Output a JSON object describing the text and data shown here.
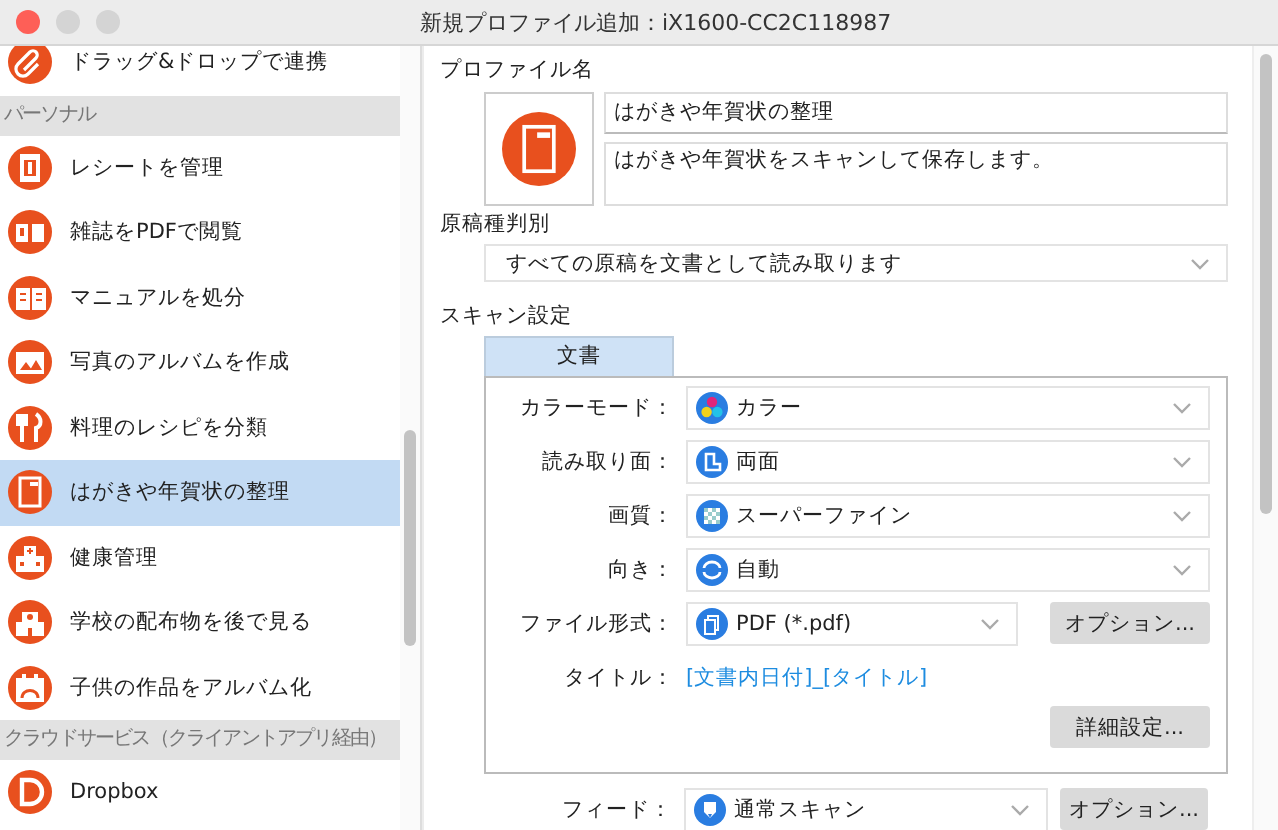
{
  "window": {
    "title": "新規プロファイル追加：iX1600-CC2C118987"
  },
  "sidebar": {
    "sections": [
      {
        "items": [
          {
            "label": "ドラッグ&ドロップで連携",
            "selected": false
          }
        ]
      },
      {
        "header": "パーソナル",
        "items": [
          {
            "label": "レシートを管理",
            "selected": false
          },
          {
            "label": "雑誌をPDFで閲覧",
            "selected": false
          },
          {
            "label": "マニュアルを処分",
            "selected": false
          },
          {
            "label": "写真のアルバムを作成",
            "selected": false
          },
          {
            "label": "料理のレシピを分類",
            "selected": false
          },
          {
            "label": "はがきや年賀状の整理",
            "selected": true
          },
          {
            "label": "健康管理",
            "selected": false
          },
          {
            "label": "学校の配布物を後で見る",
            "selected": false
          },
          {
            "label": "子供の作品をアルバム化",
            "selected": false
          }
        ]
      },
      {
        "header": "クラウドサービス（クライアントアプリ経由）",
        "items": [
          {
            "label": "Dropbox",
            "selected": false
          }
        ]
      }
    ]
  },
  "profile": {
    "label": "プロファイル名",
    "name": "はがきや年賀状の整理",
    "description": "はがきや年賀状をスキャンして保存します。"
  },
  "doc_type": {
    "label": "原稿種判別",
    "value": "すべての原稿を文書として読み取ります"
  },
  "scan_settings": {
    "label": "スキャン設定",
    "tabs": [
      {
        "label": "文書",
        "selected": true
      }
    ],
    "rows": [
      {
        "kind": "select",
        "label": "カラーモード：",
        "value": "カラー"
      },
      {
        "kind": "select",
        "label": "読み取り面：",
        "value": "両面"
      },
      {
        "kind": "select",
        "label": "画質：",
        "value": "スーパーファイン"
      },
      {
        "kind": "select",
        "label": "向き：",
        "value": "自動"
      },
      {
        "kind": "select",
        "label": "ファイル形式：",
        "value": "PDF (*.pdf)",
        "button": "オプション..."
      },
      {
        "kind": "link",
        "label": "タイトル：",
        "value": "[文書内日付]_[タイトル]"
      }
    ],
    "detail_button": "詳細設定..."
  },
  "feed": {
    "label": "フィード：",
    "value": "通常スキャン",
    "button": "オプション..."
  }
}
